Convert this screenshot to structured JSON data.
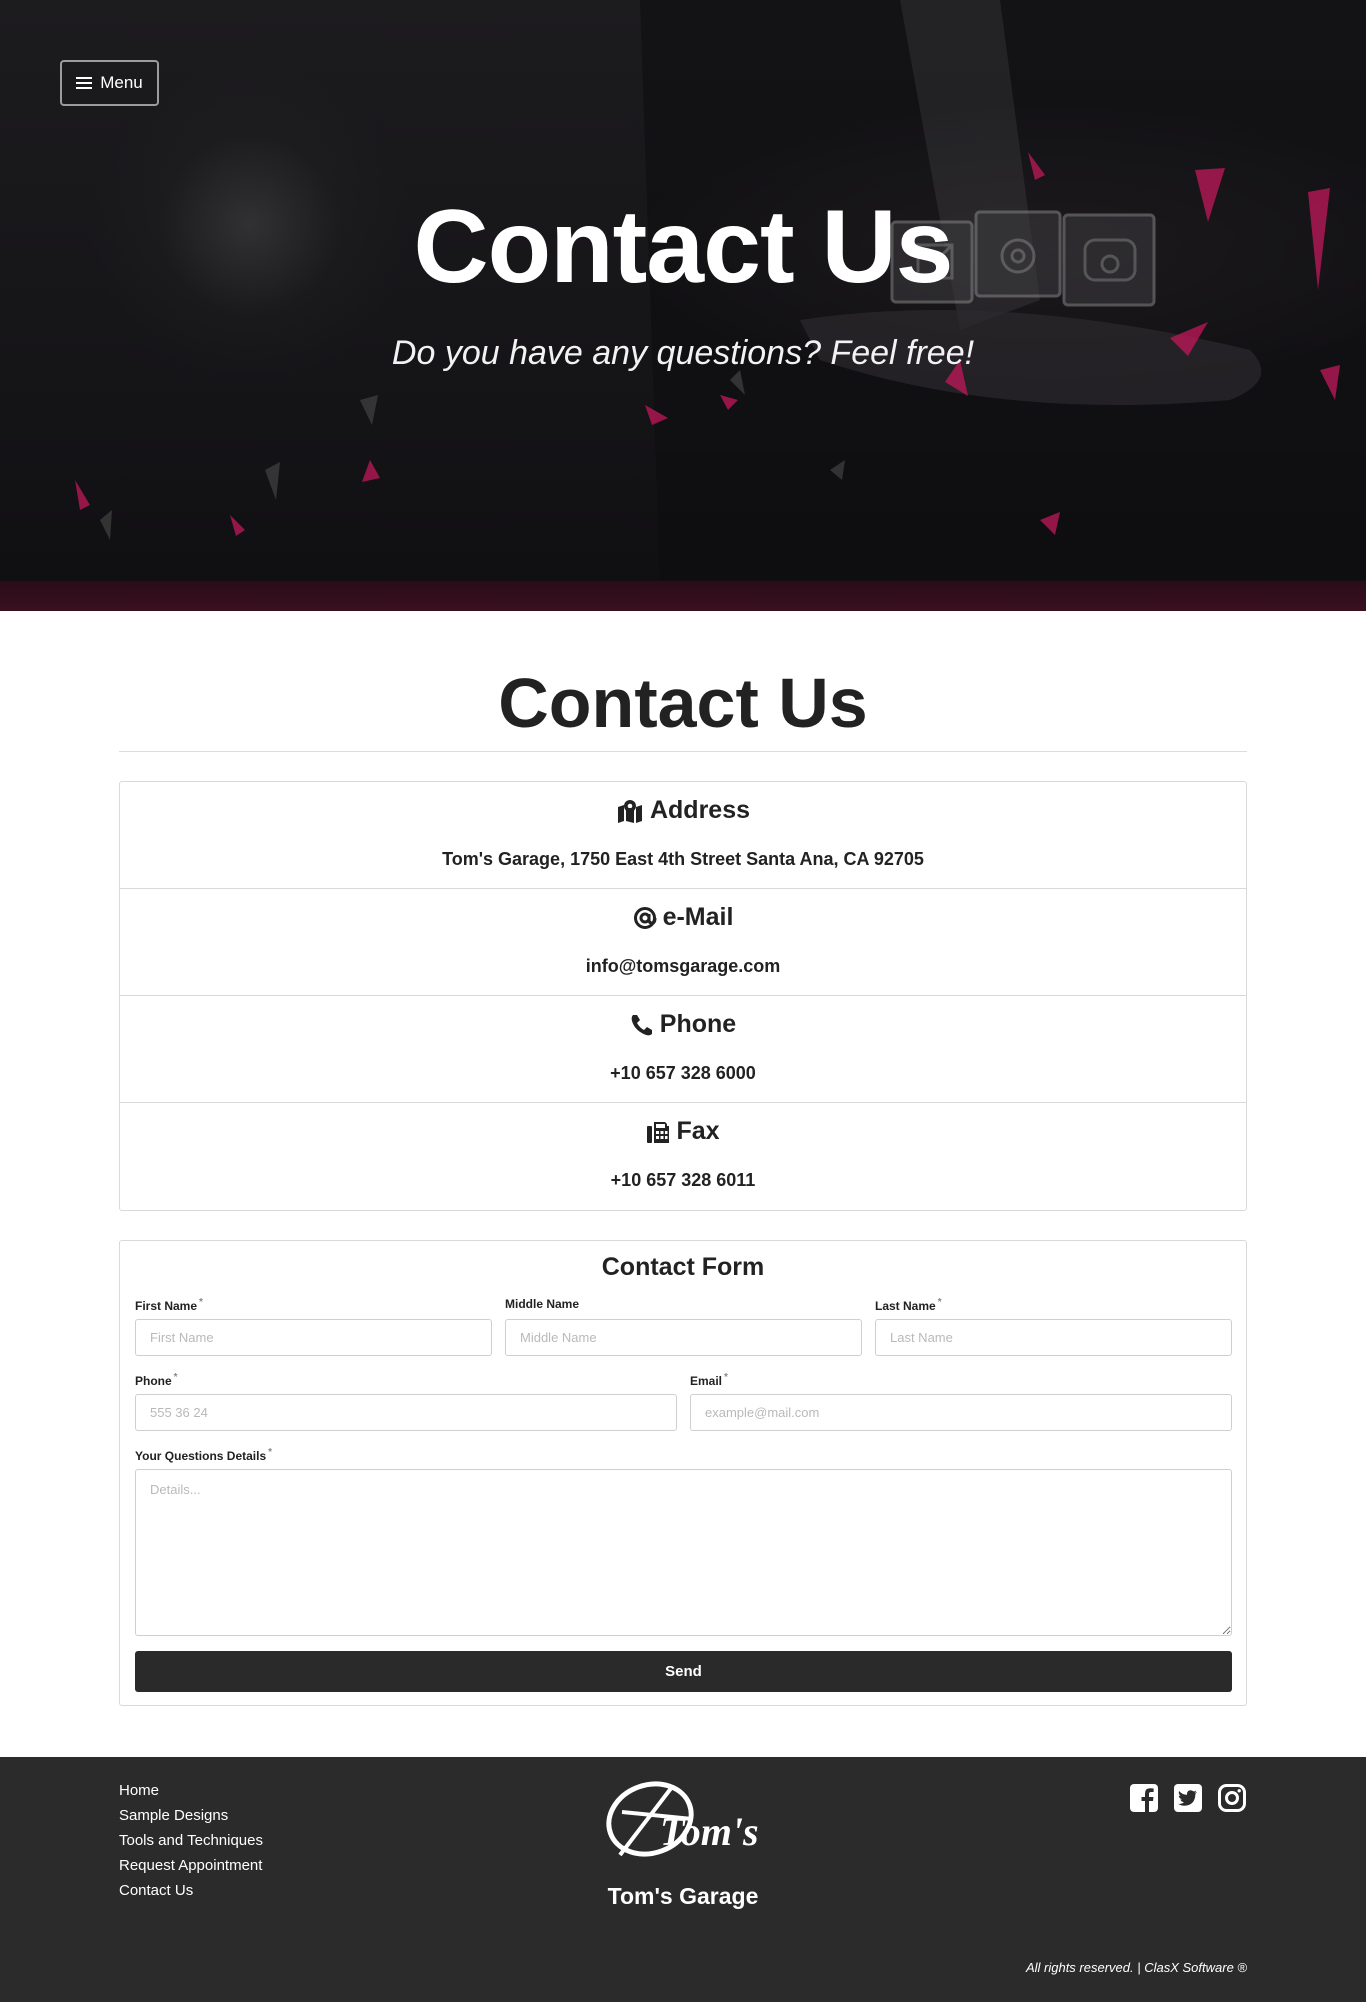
{
  "hero": {
    "menu_label": "Menu",
    "title": "Contact Us",
    "subtitle": "Do you have any questions? Feel free!"
  },
  "page": {
    "title": "Contact Us"
  },
  "contact_info": {
    "address": {
      "label": "Address",
      "value": "Tom's Garage, 1750 East 4th Street Santa Ana, CA 92705",
      "icon": "map-marker-icon"
    },
    "email": {
      "label": "e-Mail",
      "value": "info@tomsgarage.com",
      "icon": "at-icon"
    },
    "phone": {
      "label": "Phone",
      "value": "+10 657 328 6000",
      "icon": "phone-icon"
    },
    "fax": {
      "label": "Fax",
      "value": "+10 657 328 6011",
      "icon": "fax-icon"
    }
  },
  "form": {
    "title": "Contact Form",
    "first_name": {
      "label": "First Name",
      "placeholder": "First Name",
      "required_mark": "*"
    },
    "middle_name": {
      "label": "Middle Name",
      "placeholder": "Middle Name"
    },
    "last_name": {
      "label": "Last Name",
      "placeholder": "Last Name",
      "required_mark": "*"
    },
    "phone": {
      "label": "Phone",
      "placeholder": "555 36 24",
      "required_mark": "*"
    },
    "email": {
      "label": "Email",
      "placeholder": "example@mail.com",
      "required_mark": "*"
    },
    "details": {
      "label": "Your Questions Details",
      "placeholder": "Details...",
      "required_mark": "*"
    },
    "send_label": "Send"
  },
  "footer": {
    "nav": [
      "Home",
      "Sample Designs",
      "Tools and Techniques",
      "Request Appointment",
      "Contact Us"
    ],
    "logo_text": "Tom's",
    "brand": "Tom's Garage",
    "socials": [
      "facebook-icon",
      "twitter-icon",
      "instagram-icon"
    ],
    "copyright": "All rights reserved. | ClasX Software ®"
  },
  "colors": {
    "hero_bg": "#141316",
    "hero_band": "#3a1020",
    "accent_pink": "#c2185b",
    "button_dark": "#2a2a2a",
    "footer_bg": "#2b2b2b"
  }
}
